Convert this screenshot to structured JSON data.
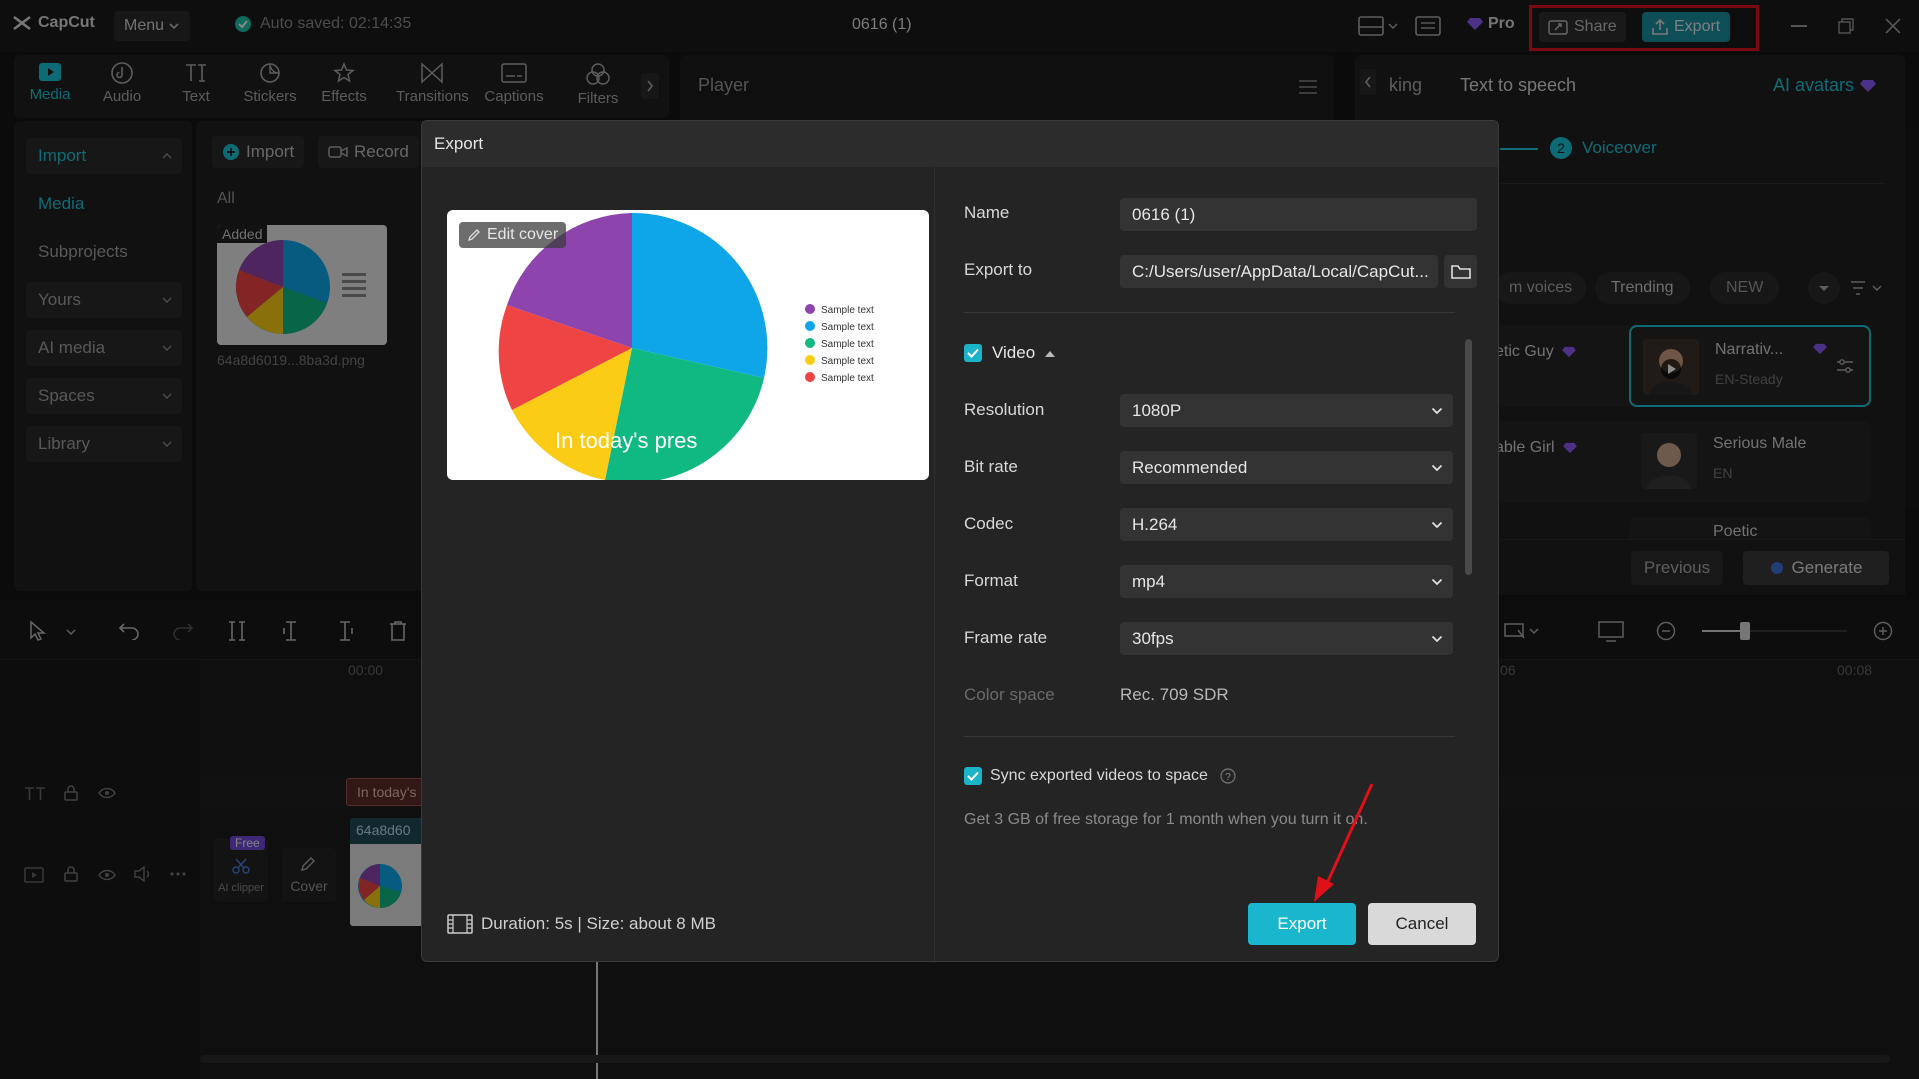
{
  "app": {
    "name": "CapCut",
    "menu_label": "Menu",
    "autosave": "Auto saved: 02:14:35",
    "project_title": "0616 (1)",
    "pro_label": "Pro",
    "share_label": "Share",
    "export_label": "Export"
  },
  "toolbar": {
    "tools": [
      {
        "label": "Media",
        "icon": "media-icon"
      },
      {
        "label": "Audio",
        "icon": "audio-icon"
      },
      {
        "label": "Text",
        "icon": "text-icon"
      },
      {
        "label": "Stickers",
        "icon": "stickers-icon"
      },
      {
        "label": "Effects",
        "icon": "effects-icon"
      },
      {
        "label": "Transitions",
        "icon": "transitions-icon"
      },
      {
        "label": "Captions",
        "icon": "captions-icon"
      },
      {
        "label": "Filters",
        "icon": "filters-icon"
      }
    ]
  },
  "sidebar": {
    "items": [
      "Import",
      "Media",
      "Subprojects",
      "Yours",
      "AI media",
      "Spaces",
      "Library"
    ]
  },
  "media_panel": {
    "import_label": "Import",
    "record_label": "Record",
    "filter_all": "All",
    "clip_badge": "Added",
    "clip_filename": "64a8d6019...8ba3d.png"
  },
  "player": {
    "title": "Player"
  },
  "right_panel": {
    "tab_partial": "king",
    "tab_tts": "Text to speech",
    "tab_ai_avatars": "AI avatars",
    "step_number": "2",
    "step_label": "Voiceover",
    "filters": [
      "m voices",
      "Trending",
      "NEW"
    ],
    "voices": [
      {
        "name": "etic Guy"
      },
      {
        "name": "Narrativ...",
        "lang": "EN-Steady"
      },
      {
        "name": "able Girl"
      },
      {
        "name": "Serious Male",
        "lang": "EN"
      },
      {
        "name": "Poetic"
      }
    ],
    "previous_label": "Previous",
    "generate_label": "Generate"
  },
  "timeline": {
    "time_start": "00:00",
    "time_end": "00:08",
    "tick_partial": "06",
    "text_clip": "In today's",
    "media_clip": "64a8d60",
    "free_badge": "Free",
    "ai_clipper_label": "AI clipper",
    "cover_label": "Cover"
  },
  "export_dialog": {
    "title": "Export",
    "edit_cover": "Edit cover",
    "preview_caption": "In today's pres",
    "legend": [
      "Sample text",
      "Sample text",
      "Sample text",
      "Sample text",
      "Sample text"
    ],
    "slice_colors": [
      "#0ea5e9",
      "#10b981",
      "#facc15",
      "#ef4444",
      "#8e44ad"
    ],
    "name_label": "Name",
    "name_value": "0616 (1)",
    "export_to_label": "Export to",
    "export_to_value": "C:/Users/user/AppData/Local/CapCut...",
    "video_label": "Video",
    "resolution_label": "Resolution",
    "resolution_value": "1080P",
    "bitrate_label": "Bit rate",
    "bitrate_value": "Recommended",
    "codec_label": "Codec",
    "codec_value": "H.264",
    "format_label": "Format",
    "format_value": "mp4",
    "framerate_label": "Frame rate",
    "framerate_value": "30fps",
    "colorspace_label": "Color space",
    "colorspace_value": "Rec. 709 SDR",
    "sync_label": "Sync exported videos to space",
    "storage_note": "Get 3 GB of free storage for 1 month when you turn it on.",
    "duration_info": "Duration: 5s | Size: about 8 MB",
    "export_button": "Export",
    "cancel_button": "Cancel"
  },
  "colors": {
    "accent": "#1ab6cd",
    "highlight_box": "#e0101a",
    "annotation_arrow": "#e0101a",
    "pro_gem": "#8b5cf6"
  }
}
